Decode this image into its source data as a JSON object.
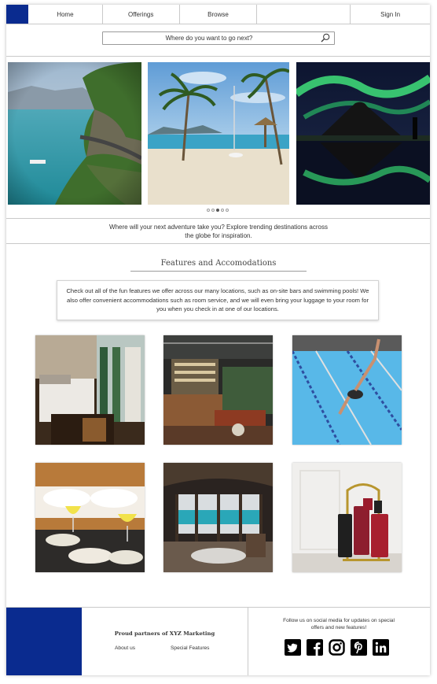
{
  "nav": {
    "home": "Home",
    "offerings": "Offerings",
    "browse": "Browse",
    "blank": "",
    "signin": "Sign In"
  },
  "search": {
    "placeholder": "Where do you want to go next?"
  },
  "carousel": {
    "images": [
      "coastal-cliff-road-photo",
      "tropical-beach-palms-photo",
      "northern-lights-mountain-photo"
    ],
    "dots": 5,
    "active_dot": 3
  },
  "tagline": "Where will your next adventure take you? Explore trending destinations across the globe for inspiration.",
  "features": {
    "title": "Features and Accomodations",
    "description": "Check out all of the fun features we offer across our many locations, such as on-site bars and swimming pools! We also offer convenient accommodations such as room service, and we will even bring your luggage to your room for you when you check in at one of our locations.",
    "photos": [
      "hotel-bedroom-photo",
      "hotel-bar-photo",
      "swimming-pool-dive-photo",
      "room-service-breakfast-photo",
      "ocean-view-suite-photo",
      "luggage-cart-photo"
    ]
  },
  "footer": {
    "partner": "Proud partners of XYZ Marketing",
    "about": "About us",
    "special": "Special Features",
    "follow": "Follow us on social media for updates on special offers and new features!",
    "social": [
      "twitter-icon",
      "facebook-icon",
      "instagram-icon",
      "pinterest-icon",
      "linkedin-icon"
    ]
  },
  "colors": {
    "brand": "#0a2b8f",
    "border": "#c9c9c9",
    "text": "#333333"
  }
}
